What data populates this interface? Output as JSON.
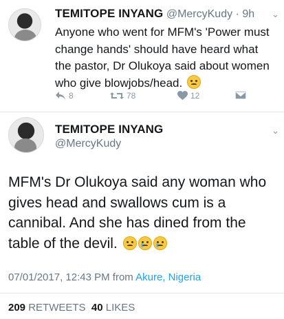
{
  "tweet1": {
    "name": "TEMITOPE INYANG",
    "handle": "@MercyKudy",
    "time": "· 9h",
    "text": "Anyone who went for MFM's 'Power must change hands' should have heard what the pastor, Dr Olukoya said about women who give blowjobs/head.",
    "emoji": "persevering-face-emoji",
    "reply_count": "8",
    "retweet_count": "78",
    "like_count": "12"
  },
  "tweet2": {
    "name": "TEMITOPE INYANG",
    "handle": "@MercyKudy",
    "text": "MFM's Dr Olukoya said any woman who gives head and swallows cum is a cannibal. And she has dined from the table of the devil.",
    "emojis": [
      "downcast-sweat-face-emoji",
      "crying-face-emoji",
      "loudly-crying-face-emoji"
    ],
    "date": "07/01/2017, 12:43 PM from ",
    "location": "Akure, Nigeria",
    "retweets_count": "209",
    "retweets_label": "RETWEETS",
    "likes_count": "40",
    "likes_label": "LIKES"
  },
  "colors": {
    "text": "#14171a",
    "muted": "#657786",
    "icon": "#8899a6",
    "link": "#1da1f2",
    "divider": "#e1e8ed"
  },
  "icons": {
    "more": "chevron-down-icon",
    "reply": "reply-icon",
    "retweet": "retweet-icon",
    "like": "heart-icon",
    "dm": "envelope-icon"
  }
}
